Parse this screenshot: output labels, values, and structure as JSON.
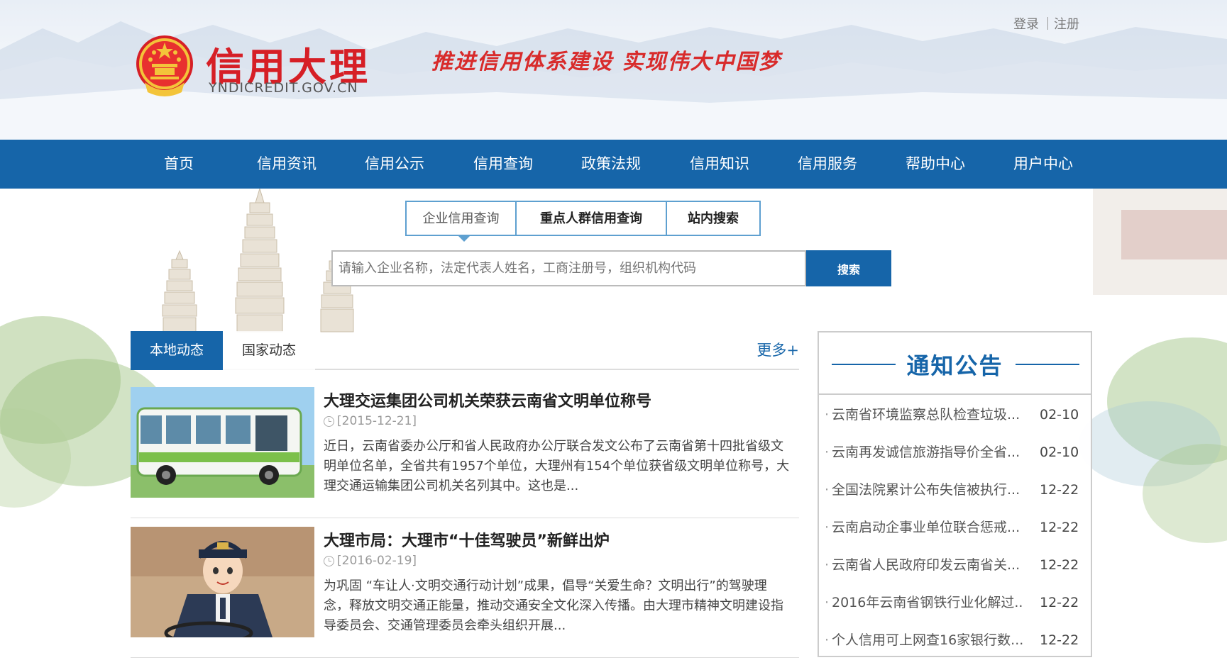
{
  "header": {
    "logo_title": "信用大理",
    "logo_domain": "YNDICREDIT.GOV.CN",
    "slogan": "推进信用体系建设 实现伟大中国梦",
    "login": "登录",
    "register": "注册",
    "brand_color": "#d61f26"
  },
  "nav": {
    "items": [
      "首页",
      "信用资讯",
      "信用公示",
      "信用查询",
      "政策法规",
      "信用知识",
      "信用服务",
      "帮助中心",
      "用户中心"
    ],
    "color": "#1665a9"
  },
  "search": {
    "tabs": [
      "企业信用查询",
      "重点人群信用查询",
      "站内搜索"
    ],
    "placeholder": "请输入企业名称，法定代表人姓名，工商注册号，组织机构代码",
    "button": "搜索"
  },
  "news": {
    "tabs": [
      "本地动态",
      "国家动态"
    ],
    "more": "更多+",
    "items": [
      {
        "title": "大理交运集团公司机关荣获云南省文明单位称号",
        "date": "[2015-12-21]",
        "summary": "近日，云南省委办公厅和省人民政府办公厅联合发文公布了云南省第十四批省级文明单位名单，全省共有1957个单位，大理州有154个单位获省级文明单位称号，大理交通运输集团公司机关名列其中。这也是..."
      },
      {
        "title": "大理市局：大理市“十佳驾驶员”新鲜出炉",
        "date": "[2016-02-19]",
        "summary": "为巩固 “车让人·文明交通行动计划”成果，倡导“关爱生命？文明出行”的驾驶理念，释放文明交通正能量，推动交通安全文化深入传播。由大理市精神文明建设指导委员会、交通管理委员会牵头组织开展..."
      }
    ]
  },
  "notice": {
    "title": "通知公告",
    "items": [
      {
        "text": "云南省环境监察总队检查垃圾...",
        "date": "02-10"
      },
      {
        "text": "云南再发诚信旅游指导价全省...",
        "date": "02-10"
      },
      {
        "text": "全国法院累计公布失信被执行...",
        "date": "12-22"
      },
      {
        "text": "云南启动企事业单位联合惩戒...",
        "date": "12-22"
      },
      {
        "text": "云南省人民政府印发云南省关...",
        "date": "12-22"
      },
      {
        "text": "2016年云南省钢铁行业化解过...",
        "date": "12-22"
      },
      {
        "text": "个人信用可上网查16家银行数...",
        "date": "12-22"
      }
    ]
  }
}
